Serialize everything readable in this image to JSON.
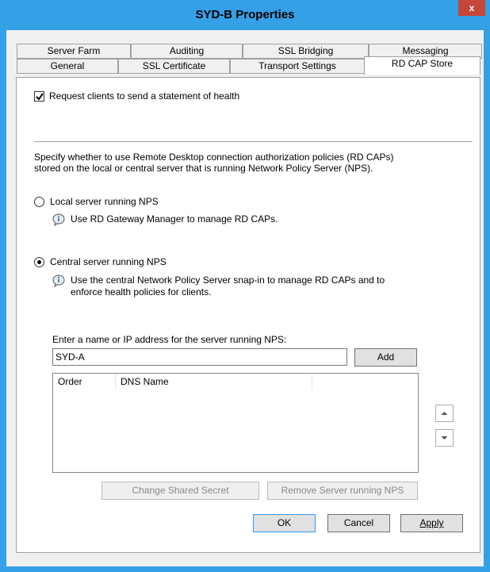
{
  "window": {
    "title": "SYD-B Properties",
    "close_glyph": "x"
  },
  "tabs": {
    "row1": [
      "Server Farm",
      "Auditing",
      "SSL Bridging",
      "Messaging"
    ],
    "row2": [
      "General",
      "SSL Certificate",
      "Transport Settings",
      "RD CAP Store"
    ],
    "active": "RD CAP Store"
  },
  "panel": {
    "health_checkbox": {
      "label": "Request clients to send a statement of health",
      "checked": true
    },
    "description_line1": "Specify whether to use Remote Desktop connection authorization policies (RD CAPs)",
    "description_line2": "stored on the local or central server that is running Network Policy Server (NPS).",
    "local_option": {
      "label": "Local server running NPS",
      "selected": false,
      "info": "Use RD Gateway Manager to manage RD CAPs."
    },
    "central_option": {
      "label": "Central server running NPS",
      "selected": true,
      "info_line1": "Use the central Network Policy Server snap-in to manage RD CAPs and to",
      "info_line2": "enforce health policies for clients."
    },
    "server_input": {
      "label": "Enter a name or IP address for the server running NPS:",
      "value": "SYD-A"
    },
    "add_button": "Add",
    "list_columns": [
      "Order",
      "DNS Name"
    ],
    "change_secret_button": "Change Shared Secret",
    "remove_server_button": "Remove Server running NPS"
  },
  "footer": {
    "ok": "OK",
    "cancel": "Cancel",
    "apply": "Apply"
  },
  "colors": {
    "title_bar": "#34a0e6",
    "close_button": "#c7463a",
    "dialog_bg": "#f0f0f0"
  },
  "icons": [
    "close-icon",
    "check-icon",
    "info-icon",
    "arrow-up-icon",
    "arrow-down-icon"
  ]
}
